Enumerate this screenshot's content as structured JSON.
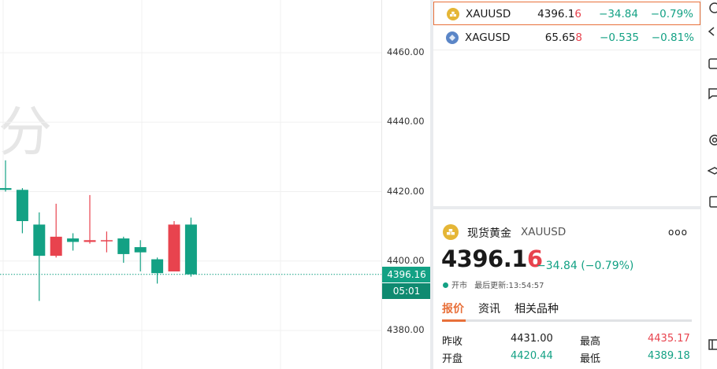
{
  "chart": {
    "watermark": "分",
    "y_ticks": [
      "4460.00",
      "4440.00",
      "4420.00",
      "4400.00",
      "4380.00"
    ],
    "current_price_label": "4396.16",
    "countdown_label": "05:01",
    "colors": {
      "up": "#e8434e",
      "down": "#13a184",
      "accent": "#e8703a"
    }
  },
  "chart_data": {
    "type": "candlestick",
    "y_range": [
      4375,
      4470
    ],
    "candles": [
      {
        "open": 4421.0,
        "close": 4420.5,
        "high": 4429.0,
        "low": 4420.0
      },
      {
        "open": 4420.5,
        "close": 4411.5,
        "high": 4421.0,
        "low": 4408.0
      },
      {
        "open": 4410.5,
        "close": 4401.5,
        "high": 4414.0,
        "low": 4388.5
      },
      {
        "open": 4401.5,
        "close": 4407.0,
        "high": 4416.5,
        "low": 4401.0
      },
      {
        "open": 4406.5,
        "close": 4405.5,
        "high": 4408.0,
        "low": 4403.0
      },
      {
        "open": 4405.5,
        "close": 4406.0,
        "high": 4419.0,
        "low": 4405.0
      },
      {
        "open": 4406.0,
        "close": 4406.0,
        "high": 4408.5,
        "low": 4402.5
      },
      {
        "open": 4406.5,
        "close": 4402.0,
        "high": 4407.0,
        "low": 4399.5
      },
      {
        "open": 4404.0,
        "close": 4402.5,
        "high": 4406.0,
        "low": 4397.0
      },
      {
        "open": 4400.5,
        "close": 4396.5,
        "high": 4401.0,
        "low": 4393.5
      },
      {
        "open": 4397.0,
        "close": 4410.5,
        "high": 4411.5,
        "low": 4397.0
      },
      {
        "open": 4410.5,
        "close": 4396.16,
        "high": 4412.5,
        "low": 4395.5
      }
    ],
    "current_price": 4396.16
  },
  "watchlist": [
    {
      "symbol": "XAUUSD",
      "price_main": "4396.1",
      "price_last": "6",
      "change": "−34.84",
      "pct": "−0.79%",
      "icon": "gold-icon",
      "icon_color": "#e5b636",
      "selected": true
    },
    {
      "symbol": "XAGUSD",
      "price_main": "65.65",
      "price_last": "8",
      "change": "−0.535",
      "pct": "−0.81%",
      "icon": "silver-icon",
      "icon_color": "#5b86c7",
      "selected": false
    }
  ],
  "detail": {
    "name": "现货黄金",
    "symbol": "XAUUSD",
    "more": "ooo",
    "price_main": "4396.1",
    "price_last": "6",
    "change": "−34.84 (−0.79%)",
    "status": "开市",
    "updated": "最后更新:13:54:57",
    "tabs": [
      "报价",
      "资讯",
      "相关品种"
    ],
    "stats": [
      {
        "label": "昨收",
        "value": "4431.00"
      },
      {
        "label": "最高",
        "value": "4435.17"
      },
      {
        "label": "开盘",
        "value": "4420.44"
      },
      {
        "label": "最低",
        "value": "4389.18"
      }
    ]
  }
}
